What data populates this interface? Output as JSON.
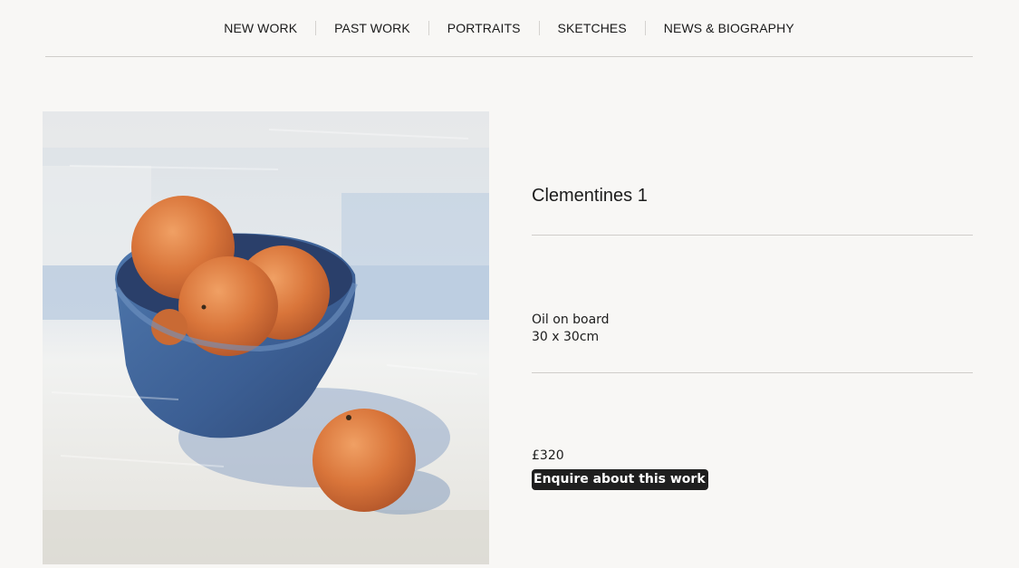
{
  "nav": {
    "items": [
      {
        "label": "NEW WORK"
      },
      {
        "label": "PAST WORK"
      },
      {
        "label": "PORTRAITS"
      },
      {
        "label": "SKETCHES"
      },
      {
        "label": "NEWS & BIOGRAPHY"
      }
    ]
  },
  "artwork": {
    "title": "Clementines 1",
    "medium": "Oil on board",
    "dimensions": "30 x 30cm",
    "price": "£320",
    "enquire_label": "Enquire about this work"
  },
  "colors": {
    "background": "#f8f7f5",
    "rule": "#cfcdca",
    "button_bg": "#1f1f1f",
    "button_text": "#ffffff"
  }
}
